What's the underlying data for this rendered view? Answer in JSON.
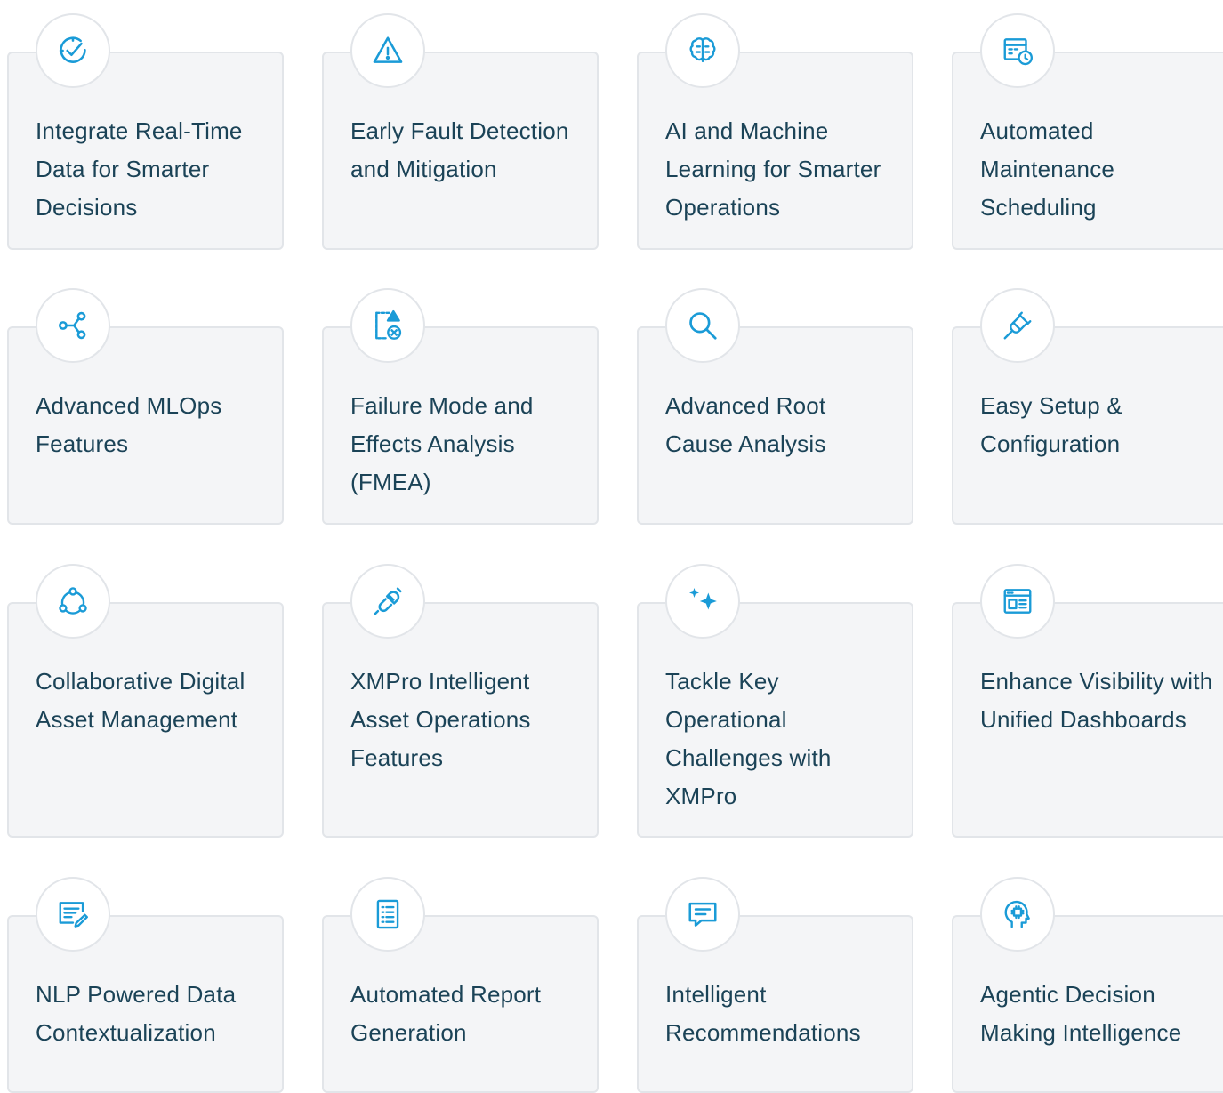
{
  "cards": [
    {
      "title": "Integrate Real-Time Data for Smarter Decisions",
      "icon": "checkmark-gauge-icon"
    },
    {
      "title": "Early Fault Detection and Mitigation",
      "icon": "warning-triangle-icon"
    },
    {
      "title": "AI and Machine Learning for Smarter Operations",
      "icon": "brain-icon"
    },
    {
      "title": "Automated Maintenance Scheduling",
      "icon": "calendar-clock-icon"
    },
    {
      "title": "Advanced MLOps Features",
      "icon": "share-nodes-icon"
    },
    {
      "title": "Failure Mode and Effects Analysis (FMEA)",
      "icon": "document-warning-icon"
    },
    {
      "title": "Advanced Root Cause Analysis",
      "icon": "search-icon"
    },
    {
      "title": "Easy Setup & Configuration",
      "icon": "plug-icon"
    },
    {
      "title": "Collaborative Digital Asset Management",
      "icon": "collaboration-cycle-icon"
    },
    {
      "title": "XMPro Intelligent Asset Operations Features",
      "icon": "connector-icon"
    },
    {
      "title": "Tackle Key Operational Challenges with XMPro",
      "icon": "sparkles-icon"
    },
    {
      "title": "Enhance Visibility with Unified Dashboards",
      "icon": "dashboard-icon"
    },
    {
      "title": "NLP Powered Data Contextualization",
      "icon": "text-edit-icon"
    },
    {
      "title": "Automated Report Generation",
      "icon": "report-document-icon"
    },
    {
      "title": "Intelligent Recommendations",
      "icon": "chat-bubble-icon"
    },
    {
      "title": "Agentic Decision Making Intelligence",
      "icon": "head-chip-icon"
    }
  ],
  "colors": {
    "icon": "#1a9bd7",
    "text": "#1b4357",
    "card_bg": "#f4f5f7",
    "card_border": "#e2e5e9"
  }
}
